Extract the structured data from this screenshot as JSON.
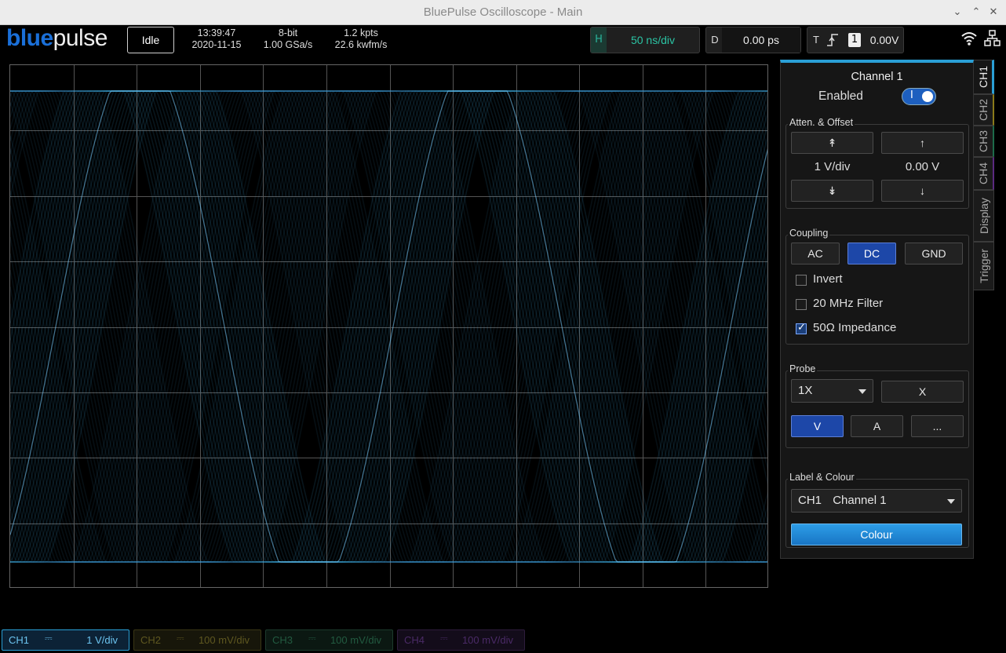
{
  "window": {
    "title": "BluePulse Oscilloscope - Main",
    "controls": [
      "⌄",
      "⌃",
      "✕"
    ]
  },
  "logo": {
    "part1": "blue",
    "part2": "pulse"
  },
  "toolbar": {
    "state_button": "Idle",
    "time": "13:39:47",
    "date": "2020-11-15",
    "bits": "8-bit",
    "sample_rate": "1.00 GSa/s",
    "points": "1.2 kpts",
    "wfm_rate": "22.6 kwfm/s",
    "horizontal": {
      "label": "H",
      "value": "50 ns/div"
    },
    "delay": {
      "label": "D",
      "value": "0.00 ps"
    },
    "trigger": {
      "label": "T",
      "channel": "1",
      "level": "0.00V"
    }
  },
  "panel": {
    "title": "Channel 1",
    "enabled_label": "Enabled",
    "enabled": true,
    "toggle_mark": "I",
    "atten_group": "Atten. & Offset",
    "scale_value": "1 V/div",
    "offset_value": "0.00 V",
    "coupling_group": "Coupling",
    "coupling": [
      "AC",
      "DC",
      "GND"
    ],
    "coupling_selected": "DC",
    "invert_label": "Invert",
    "filter_label": "20 MHz Filter",
    "impedance_label": "50Ω Impedance",
    "invert": false,
    "filter": false,
    "impedance": true,
    "probe_group": "Probe",
    "probe_value": "1X",
    "probe_x": "X",
    "probe_units": [
      "V",
      "A",
      "..."
    ],
    "probe_unit_selected": "V",
    "label_group": "Label & Colour",
    "label_short": "CH1",
    "label_name": "Channel 1",
    "colour_button": "Colour"
  },
  "tabs": [
    "CH1",
    "CH2",
    "CH3",
    "CH4",
    "Display",
    "Trigger"
  ],
  "channels": [
    {
      "name": "CH1",
      "vdiv": "1 V/div",
      "color": "#2a9fd6"
    },
    {
      "name": "CH2",
      "vdiv": "100 mV/div",
      "color": "#8a7a1a"
    },
    {
      "name": "CH3",
      "vdiv": "100 mV/div",
      "color": "#1d6b4a"
    },
    {
      "name": "CH4",
      "vdiv": "100 mV/div",
      "color": "#5a2a80"
    }
  ],
  "colors": {
    "trace": "#3fa9e0",
    "accent": "#2a9fd6",
    "active_button": "#1d47a8"
  }
}
